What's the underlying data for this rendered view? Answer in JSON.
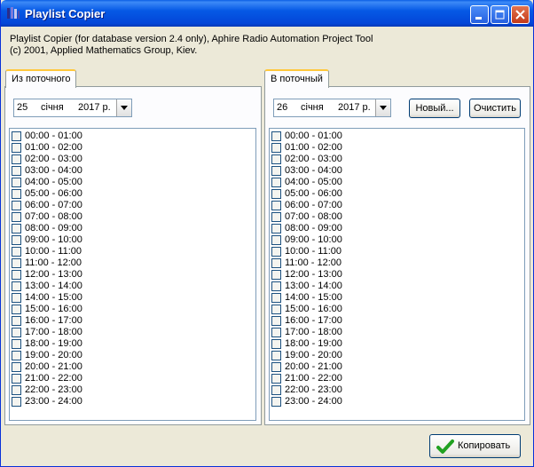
{
  "window": {
    "title": "Playlist Copier"
  },
  "info": {
    "line1": "Playlist Copier (for database version 2.4 only), Aphire Radio Automation Project Tool",
    "line2": "(c) 2001, Applied Mathematics Group, Kiev."
  },
  "left": {
    "tab_label": "Из поточного",
    "date": {
      "day": "25",
      "month": "січня",
      "year": "2017 р."
    }
  },
  "right": {
    "tab_label": "В поточный",
    "date": {
      "day": "26",
      "month": "січня",
      "year": "2017 р."
    },
    "new_button": "Новый...",
    "clear_button": "Очистить"
  },
  "hours": [
    "00:00 - 01:00",
    "01:00 - 02:00",
    "02:00 - 03:00",
    "03:00 - 04:00",
    "04:00 - 05:00",
    "05:00 - 06:00",
    "06:00 - 07:00",
    "07:00 - 08:00",
    "08:00 - 09:00",
    "09:00 - 10:00",
    "10:00 - 11:00",
    "11:00 - 12:00",
    "12:00 - 13:00",
    "13:00 - 14:00",
    "14:00 - 15:00",
    "15:00 - 16:00",
    "16:00 - 17:00",
    "17:00 - 18:00",
    "18:00 - 19:00",
    "19:00 - 20:00",
    "20:00 - 21:00",
    "21:00 - 22:00",
    "22:00 - 23:00",
    "23:00 - 24:00"
  ],
  "copy_button": "Копировать",
  "icons": {
    "app": "playlist-app-icon",
    "copy": "checkmark-icon",
    "dropdown": "chevron-down-icon"
  },
  "colors": {
    "titlebar": "#0559e5",
    "face": "#ece9d8",
    "tab_highlight": "#ffc83c",
    "checkmark": "#21a121"
  }
}
